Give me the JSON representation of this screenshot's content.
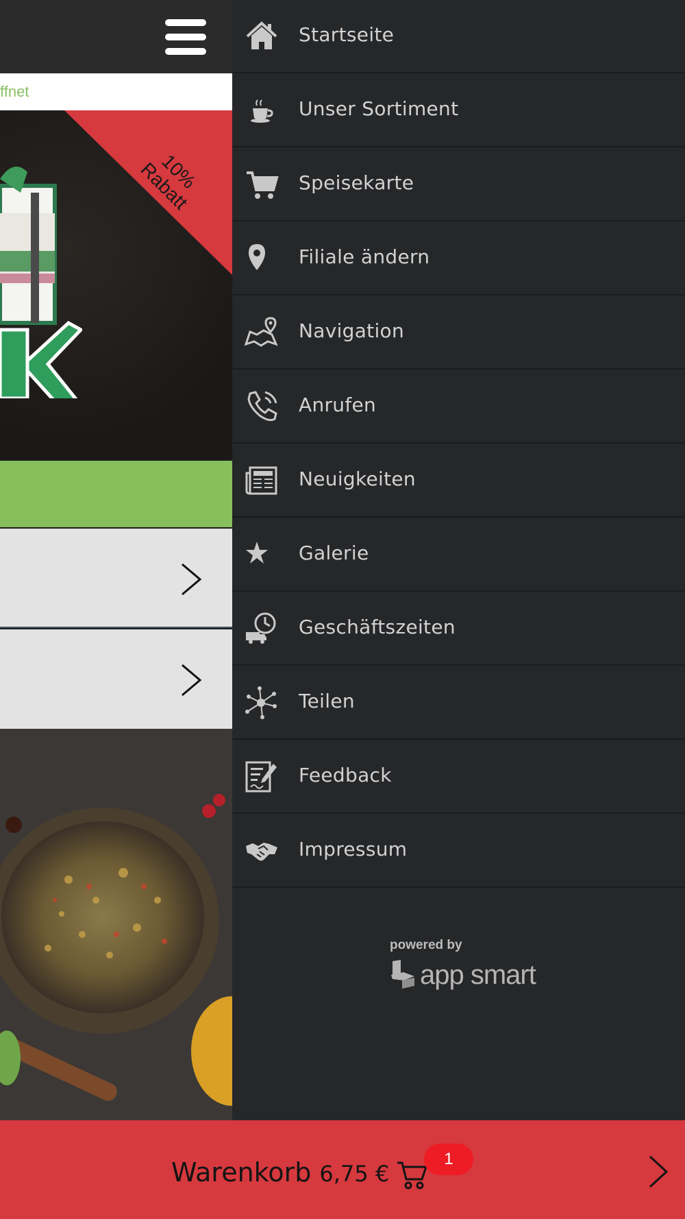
{
  "left_panel": {
    "open_status_fragment": "ffnet",
    "promo_ribbon": "10%\nRabatt"
  },
  "menu": {
    "items": [
      {
        "label": "Startseite",
        "icon": "home-icon"
      },
      {
        "label": "Unser Sortiment",
        "icon": "coffee-cup-icon"
      },
      {
        "label": "Speisekarte",
        "icon": "cart-icon"
      },
      {
        "label": "Filiale ändern",
        "icon": "map-pin-icon"
      },
      {
        "label": "Navigation",
        "icon": "map-icon"
      },
      {
        "label": "Anrufen",
        "icon": "phone-icon"
      },
      {
        "label": "Neuigkeiten",
        "icon": "newspaper-icon"
      },
      {
        "label": "Galerie",
        "icon": "star-icon"
      },
      {
        "label": "Geschäftszeiten",
        "icon": "clock-truck-icon"
      },
      {
        "label": "Teilen",
        "icon": "share-icon"
      },
      {
        "label": "Feedback",
        "icon": "feedback-icon"
      },
      {
        "label": "Impressum",
        "icon": "handshake-icon"
      }
    ]
  },
  "footer_brand": {
    "powered_by": "powered by",
    "brand": "app smart"
  },
  "cart": {
    "label": "Warenkorb",
    "price": "6,75 €",
    "count": "1"
  },
  "colors": {
    "drawer_bg": "#262729",
    "accent_red": "#d6393e",
    "accent_green": "#86bf5c",
    "badge_red": "#ee1c24"
  }
}
